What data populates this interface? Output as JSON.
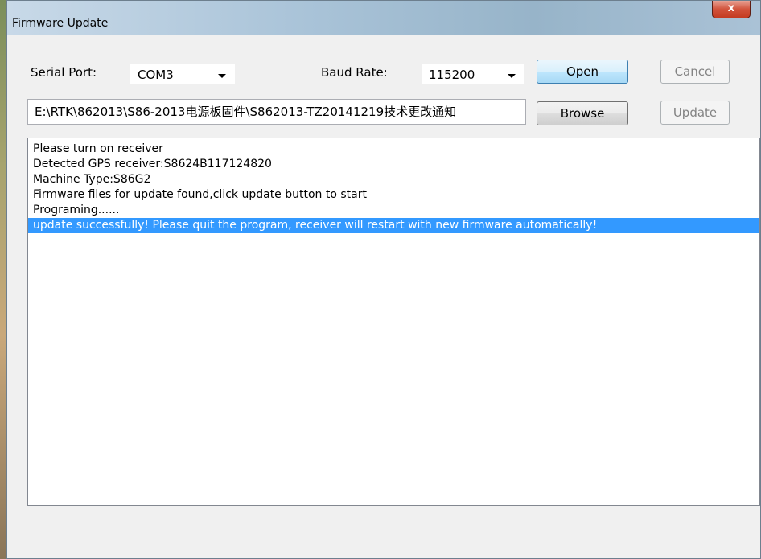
{
  "window": {
    "title": "Firmware Update",
    "close_glyph": "x"
  },
  "serial": {
    "label": "Serial Port:",
    "value": "COM3"
  },
  "baud": {
    "label": "Baud Rate:",
    "value": "115200"
  },
  "buttons": {
    "open": "Open",
    "cancel": "Cancel",
    "browse": "Browse",
    "update": "Update"
  },
  "file_path": "E:\\RTK\\862013\\S86-2013电源板固件\\S862013-TZ20141219技术更改通知",
  "log": {
    "lines": [
      "Please turn on receiver",
      "Detected GPS receiver:S8624B117124820",
      "Machine Type:S86G2",
      "Firmware files for update found,click update button to start",
      "Programing......",
      "update successfully! Please quit the program, receiver will restart with new firmware automatically!"
    ],
    "selected_index": 5
  },
  "colors": {
    "selection": "#3399ff",
    "default_button_border": "#3c7fb1"
  }
}
